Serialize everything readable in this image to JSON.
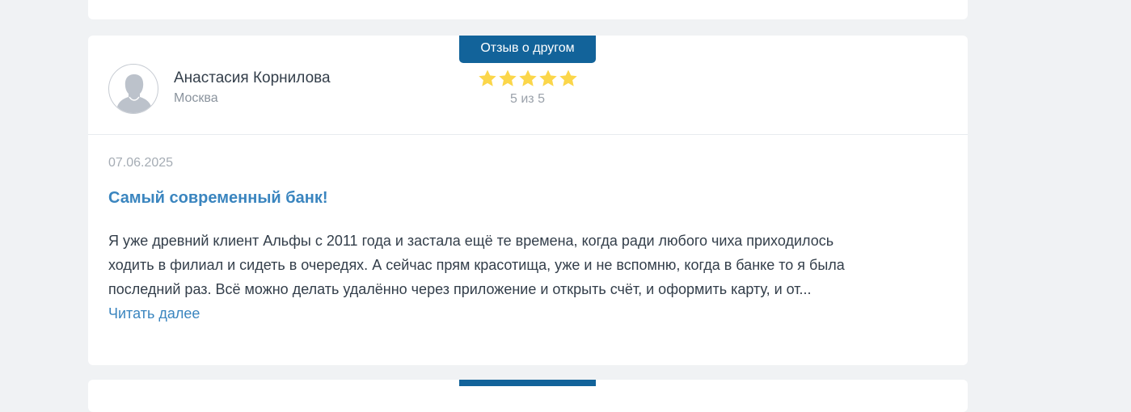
{
  "colors": {
    "page_bg": "#f0f2f4",
    "card_bg": "#ffffff",
    "tag_bg": "#12639a",
    "accent": "#3a85bf",
    "star": "#fbd64a"
  },
  "review": {
    "tag": "Отзыв о другом",
    "author": {
      "name": "Анастасия Корнилова",
      "city": "Москва",
      "avatar_icon": "user-silhouette-icon"
    },
    "rating": {
      "value": 5,
      "max": 5,
      "text": "5 из 5",
      "star_icon": "star-icon"
    },
    "date": "07.06.2025",
    "title": "Самый современный банк!",
    "body_lines": [
      "Я уже древний клиент Альфы с 2011 года и застала ещё те времена, когда ради любого чиха приходилось",
      "ходить в филиал и сидеть в очередях. А сейчас прям красотища, уже и не вспомню, когда в банке то я была",
      "последний раз. Всё можно делать удалённо через приложение и открыть счёт, и оформить карту, и от..."
    ],
    "read_more": "Читать далее"
  }
}
